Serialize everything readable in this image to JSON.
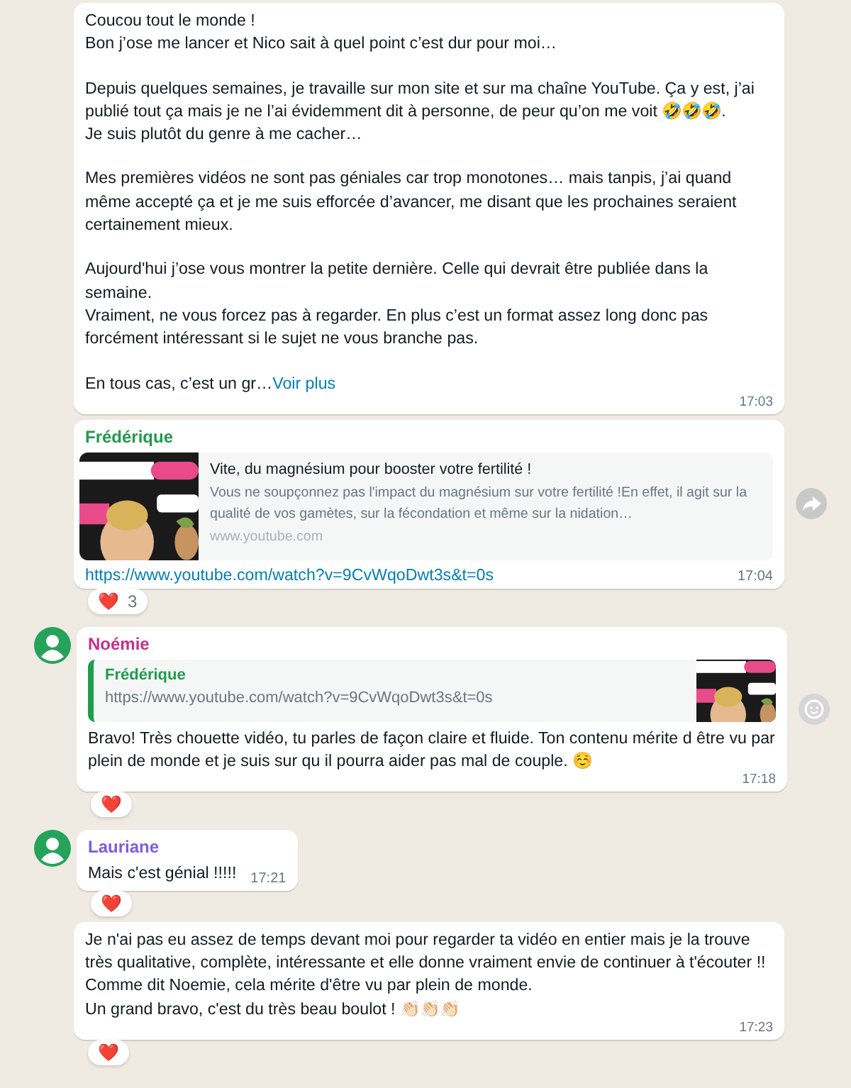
{
  "messages": [
    {
      "avatar": false,
      "paragraphs": [
        "Coucou tout le monde !\nBon j’ose me lancer et Nico sait à quel point c’est dur pour moi…",
        "Depuis quelques semaines, je travaille sur mon site et sur ma chaîne YouTube. Ça y est, j’ai publié tout ça mais je ne l’ai évidemment dit à personne, de peur qu’on me voit 🤣🤣🤣.\nJe suis plutôt du genre à me cacher…",
        "Mes premières vidéos ne sont pas géniales car trop monotones… mais tanpis, j’ai quand même accepté ça et je me suis efforcée d’avancer, me disant que les prochaines seraient certainement mieux.",
        "Aujourd'hui j’ose vous montrer la petite dernière. Celle qui devrait être publiée dans la semaine.\nVraiment, ne vous forcez pas à regarder. En plus c’est un format assez long donc pas forcément intéressant si le sujet ne vous branche pas.",
        "En tous cas, c’est un gr…"
      ],
      "more": "Voir plus",
      "time": "17:03"
    },
    {
      "avatar": false,
      "sender": "Frédérique",
      "color": "#1f9c4c",
      "preview": {
        "title": "Vite, du magnésium pour booster votre fertilité !",
        "description": "Vous ne soupçonnez pas l'impact du magnésium sur votre fertilité !En effet, il agit sur la qualité de vos gamètes, sur la fécondation et même sur la nidation…",
        "domain": "www.youtube.com"
      },
      "link": "https://www.youtube.com/watch?v=9CvWqoDwt3s&t=0s",
      "time": "17:04",
      "forward_button": true,
      "reaction": {
        "emoji": "❤️",
        "count": "3"
      }
    },
    {
      "avatar": true,
      "sender": "Noémie",
      "color": "#c2318f",
      "quote": {
        "sender": "Frédérique",
        "color": "#1f9c4c",
        "text": "https://www.youtube.com/watch?v=9CvWqoDwt3s&t=0s"
      },
      "paragraphs": [
        "Bravo! Très chouette vidéo, tu parles de façon claire et fluide. Ton contenu mérite d être vu par plein de monde et je suis sur qu il pourra aider pas mal de couple. ☺️"
      ],
      "time": "17:18",
      "react_button": true,
      "reaction": {
        "emoji": "❤️"
      }
    },
    {
      "avatar": true,
      "sender": "Lauriane",
      "color": "#7b5ce5",
      "paragraphs": [
        "Mais c'est génial !!!!!"
      ],
      "time": "17:21",
      "compact": true,
      "reaction": {
        "emoji": "❤️"
      }
    },
    {
      "avatar": false,
      "paragraphs": [
        "Je n'ai pas eu assez de temps devant moi pour regarder ta vidéo en entier mais je la trouve très qualitative, complète, intéressante et elle donne vraiment envie de continuer à t'écouter !! Comme dit Noemie, cela mérite d'être vu par plein de monde.\nUn grand bravo, c'est du très beau boulot ! 👏🏻👏🏻👏🏻"
      ],
      "time": "17:23",
      "reaction": {
        "emoji": "❤️"
      }
    }
  ]
}
